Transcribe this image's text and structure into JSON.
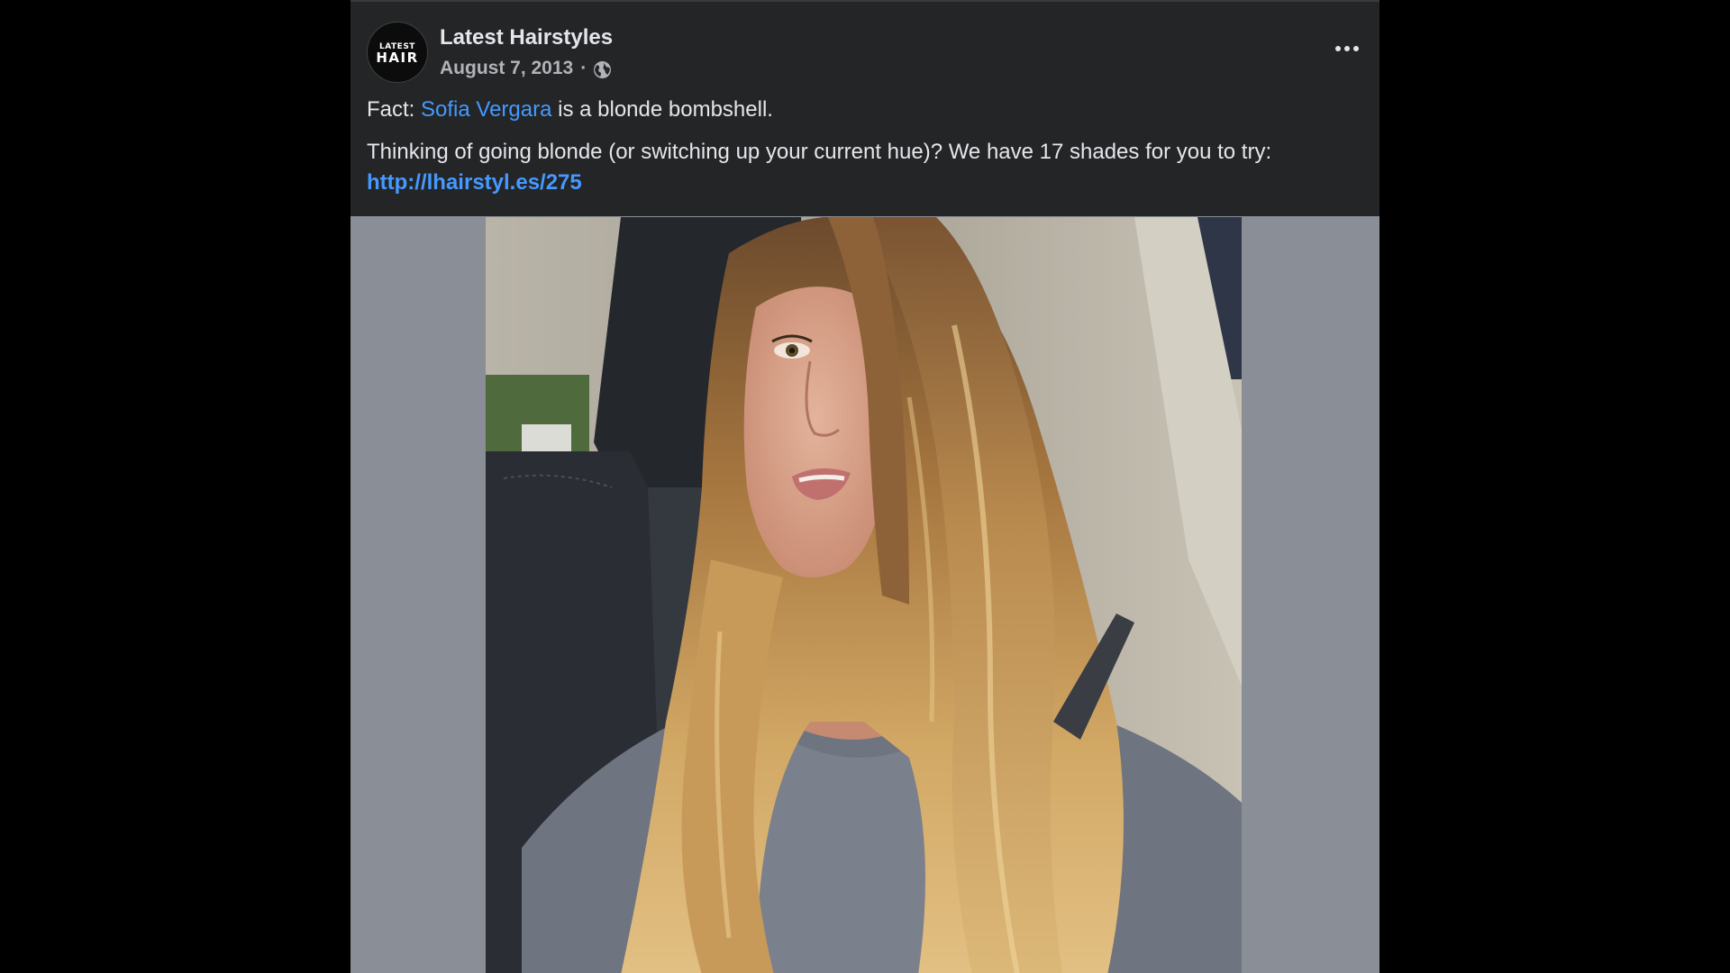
{
  "post": {
    "page_name": "Latest Hairstyles",
    "avatar": {
      "line1": "LATEST",
      "line2": "HAIR"
    },
    "date": "August 7, 2013",
    "separator": "·",
    "audience_icon": "globe-icon",
    "more_icon": "more-options-icon",
    "text": {
      "line1_prefix": "Fact: ",
      "mention": "Sofia Vergara",
      "line1_suffix": " is a blonde bombshell.",
      "line2": "Thinking of going blonde (or switching up your current hue)? We have 17 shades for you to try:",
      "link": "http://lhairstyl.es/275"
    },
    "photo": {
      "description_icon": "selfie-photo"
    }
  },
  "colors": {
    "background": "#000000",
    "card": "#242526",
    "primary_text": "#e4e6eb",
    "secondary_text": "#b0b3b8",
    "link": "#4599ff",
    "media_letterbox": "#8a8e96"
  }
}
